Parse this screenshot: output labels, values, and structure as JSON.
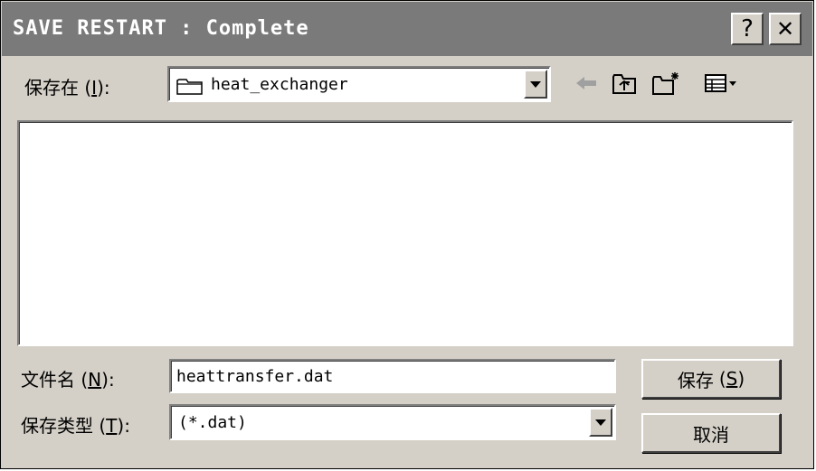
{
  "window": {
    "title": "SAVE RESTART : Complete",
    "help_glyph": "?",
    "close_glyph": "✕"
  },
  "save_in": {
    "label": "保存在",
    "hotkey_open": "(",
    "hotkey": "I",
    "hotkey_close": "):",
    "value": "heat_exchanger"
  },
  "toolbar": {
    "icons": [
      "back-arrow-icon",
      "up-folder-icon",
      "new-folder-icon",
      "view-menu-icon"
    ]
  },
  "file_name": {
    "label": "文件名",
    "hotkey_open": "(",
    "hotkey": "N",
    "hotkey_close": "):",
    "value": "heattransfer.dat"
  },
  "file_type": {
    "label": "保存类型",
    "hotkey_open": "(",
    "hotkey": "T",
    "hotkey_close": "):",
    "value": "(*.dat)"
  },
  "buttons": {
    "save_label": "保存",
    "save_hotkey_open": "(",
    "save_hotkey": "S",
    "save_hotkey_close": ")",
    "cancel_label": "取消"
  },
  "colors": {
    "titlebar": "#7a7a7a",
    "dialog_face": "#d4d0c8",
    "field_bg": "#ffffff"
  }
}
